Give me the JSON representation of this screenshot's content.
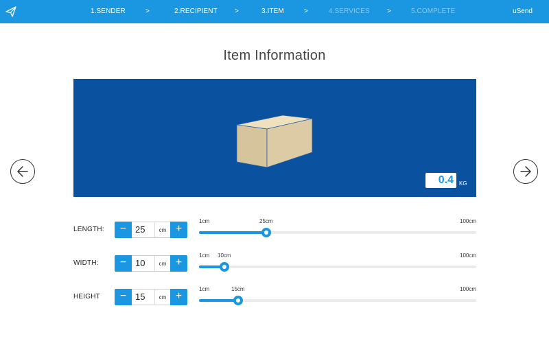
{
  "topbar": {
    "steps": [
      {
        "label": "1.SENDER",
        "state": "done"
      },
      {
        "label": "2.RECIPIENT",
        "state": "done"
      },
      {
        "label": "3.ITEM",
        "state": "current"
      },
      {
        "label": "4.SERVICES",
        "state": "upcoming"
      },
      {
        "label": "5.COMPLETE",
        "state": "upcoming"
      }
    ],
    "separator": ">",
    "brand": "uSend",
    "logo_icon": "paper-plane-icon"
  },
  "title": "Item Information",
  "preview": {
    "weight_value": "0.4",
    "weight_unit": "KG",
    "box_color": "#d8c59c",
    "background_color": "#0a529f"
  },
  "nav": {
    "prev_icon": "arrow-left-icon",
    "next_icon": "arrow-right-icon"
  },
  "dimensions": [
    {
      "label": "LENGTH:",
      "value": "25",
      "unit": "cm",
      "min_label": "1cm",
      "max_label": "100cm",
      "current_label": "25cm",
      "min": 1,
      "max": 100,
      "current": 25
    },
    {
      "label": "WIDTH:",
      "value": "10",
      "unit": "cm",
      "min_label": "1cm",
      "max_label": "100cm",
      "current_label": "10cm",
      "min": 1,
      "max": 100,
      "current": 10
    },
    {
      "label": "HEIGHT",
      "value": "15",
      "unit": "cm",
      "min_label": "1cm",
      "max_label": "100cm",
      "current_label": "15cm",
      "min": 1,
      "max": 100,
      "current": 15
    }
  ],
  "stepper_minus": "−",
  "stepper_plus": "+",
  "accent_color": "#1a97e0"
}
